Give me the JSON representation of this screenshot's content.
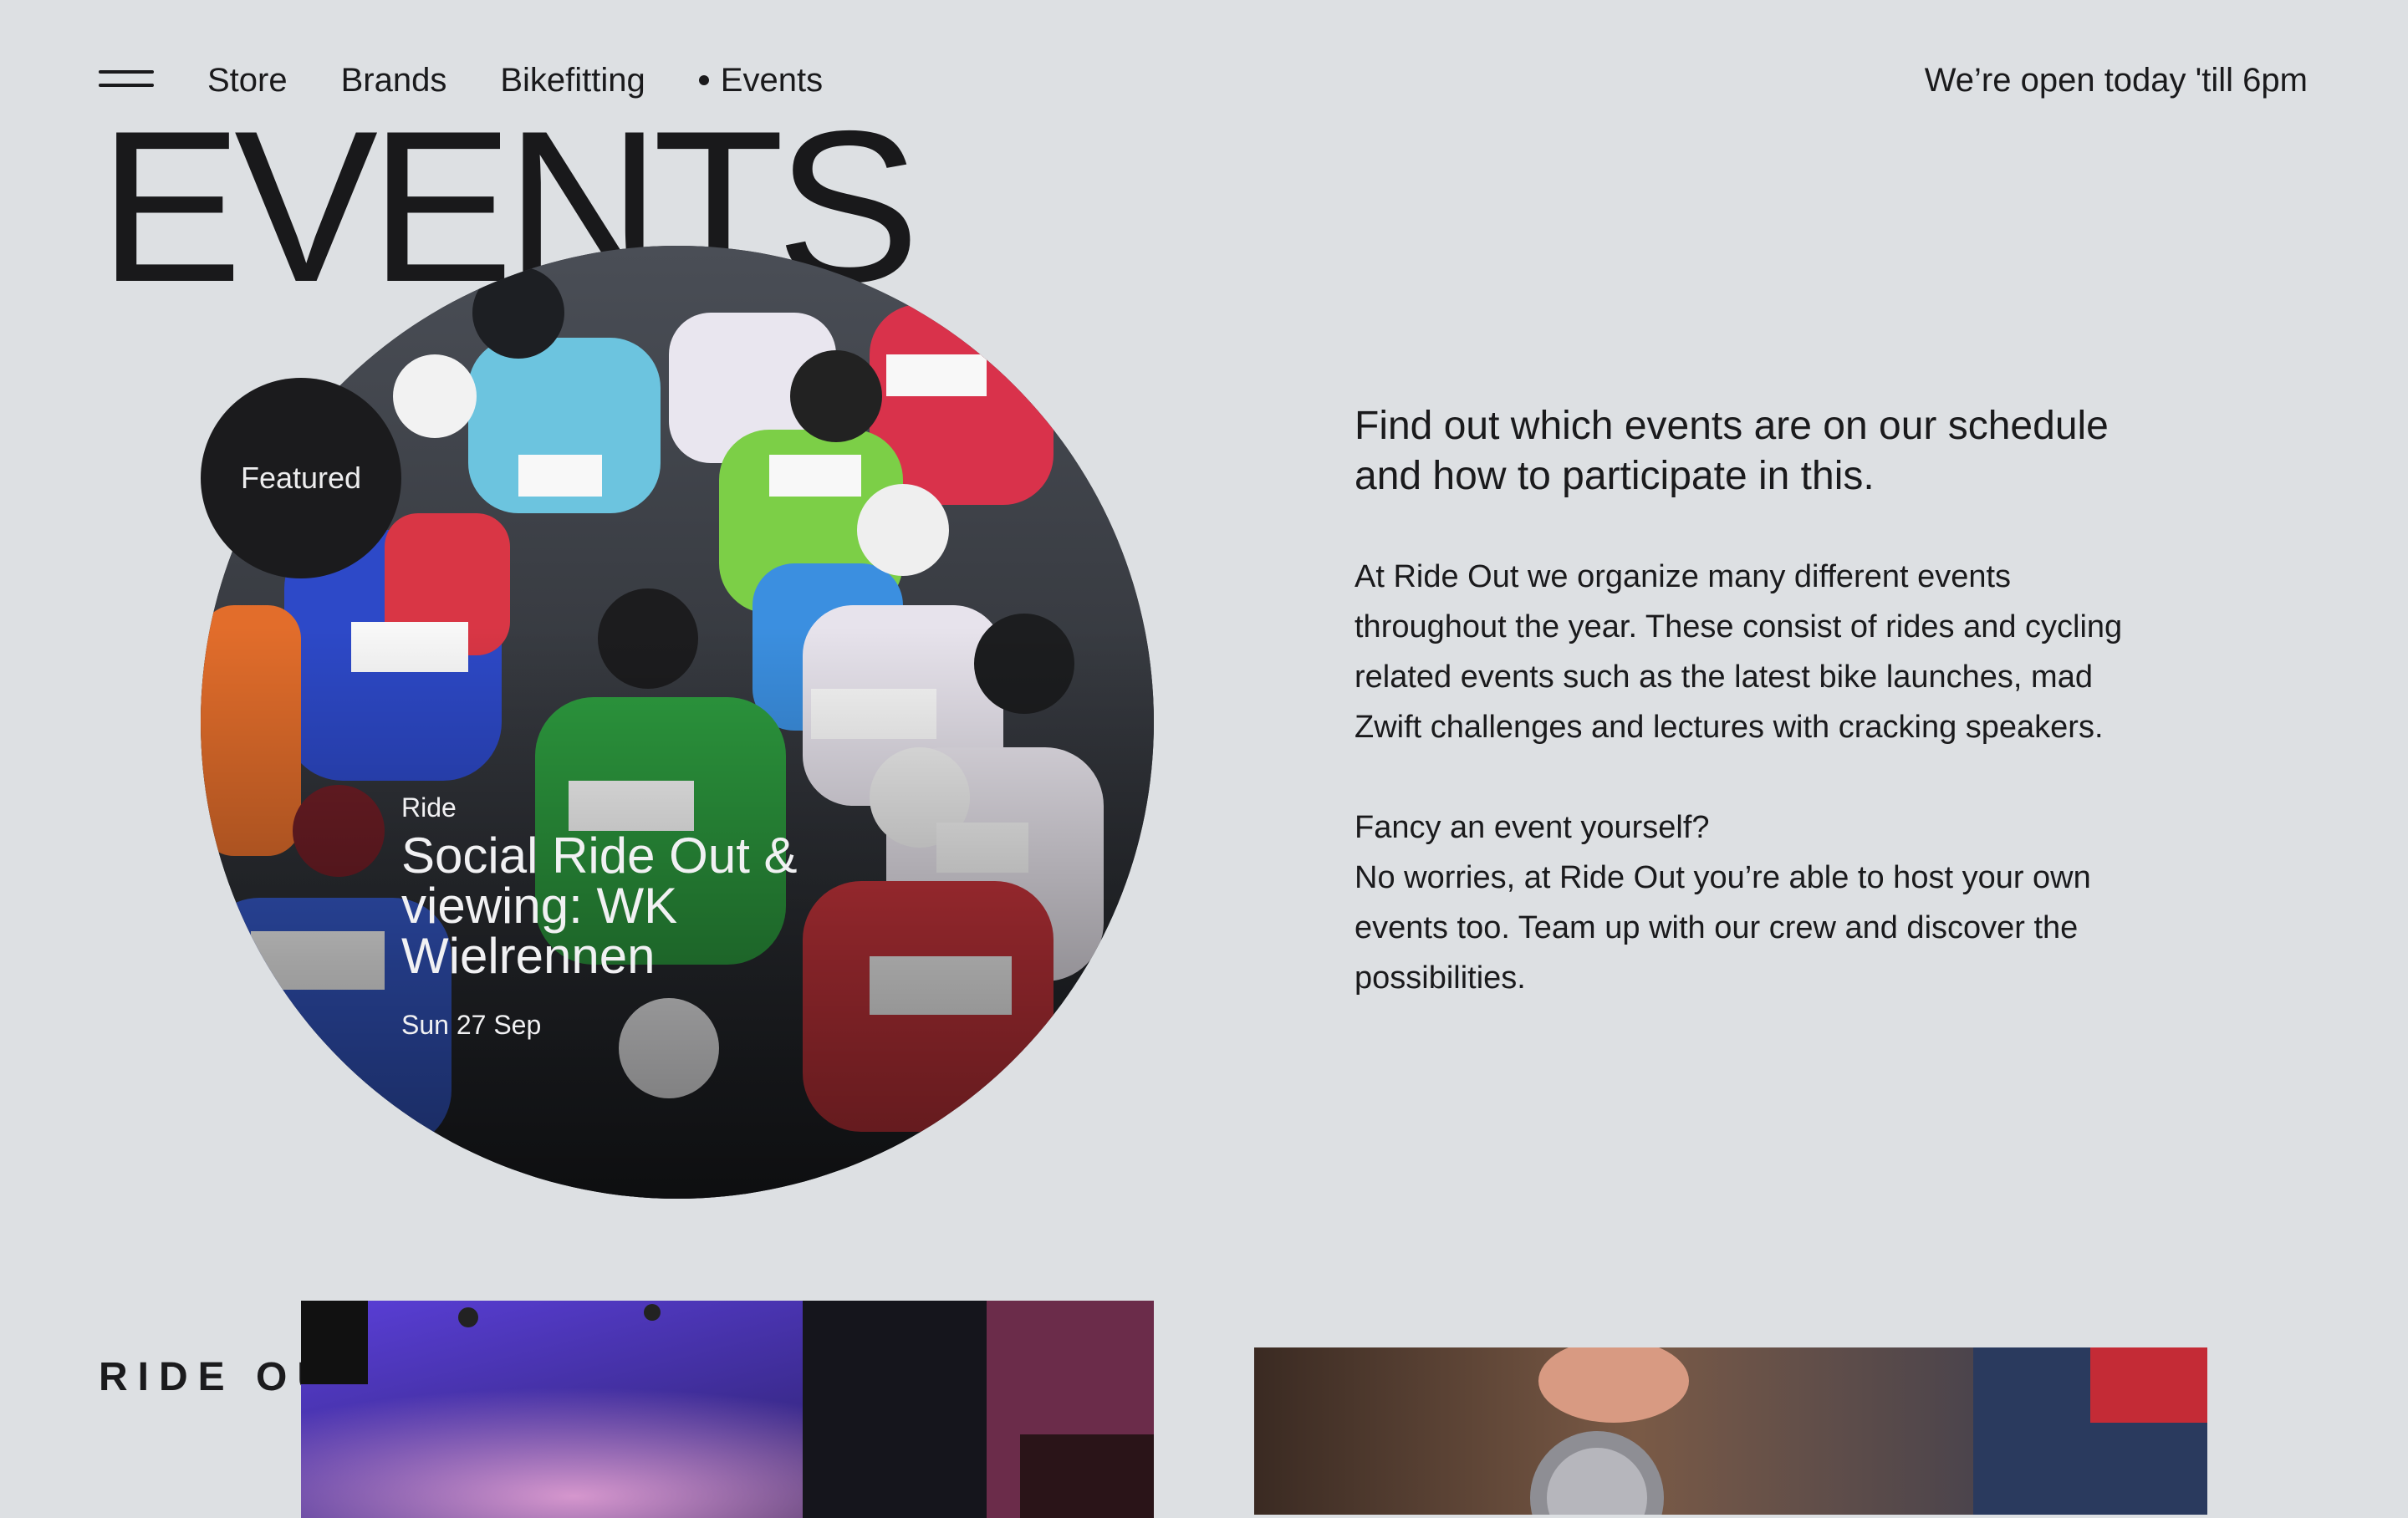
{
  "nav": {
    "menu_icon": "hamburger-menu-icon",
    "items": [
      {
        "label": "Store",
        "active": false
      },
      {
        "label": "Brands",
        "active": false
      },
      {
        "label": "Bikefitting",
        "active": false
      },
      {
        "label": "Events",
        "active": true
      }
    ],
    "open_hours": "We’re open today 'till 6pm"
  },
  "hero": {
    "title": "EVENTS"
  },
  "featured": {
    "badge": "Featured",
    "category": "Ride",
    "title": "Social Ride Out & viewing: WK Wielrennen",
    "date": "Sun 27 Sep"
  },
  "intro": {
    "lead": "Find out which events are on our schedule and how to participate in this.",
    "body": "At Ride Out we organize many different events throughout the year. These consist of rides and cycling related events such as the latest bike launches, mad Zwift challenges and lectures with cracking speakers.",
    "sub_heading": "Fancy an event yourself?",
    "sub_body": "No worries, at Ride Out you’re able to host your own events too. Team up with our crew and discover the possibilities."
  },
  "section": {
    "label": "RIDE OUT"
  },
  "colors": {
    "background": "#dde0e3",
    "text": "#1a1a1c",
    "badge": "#1b1b1d"
  }
}
